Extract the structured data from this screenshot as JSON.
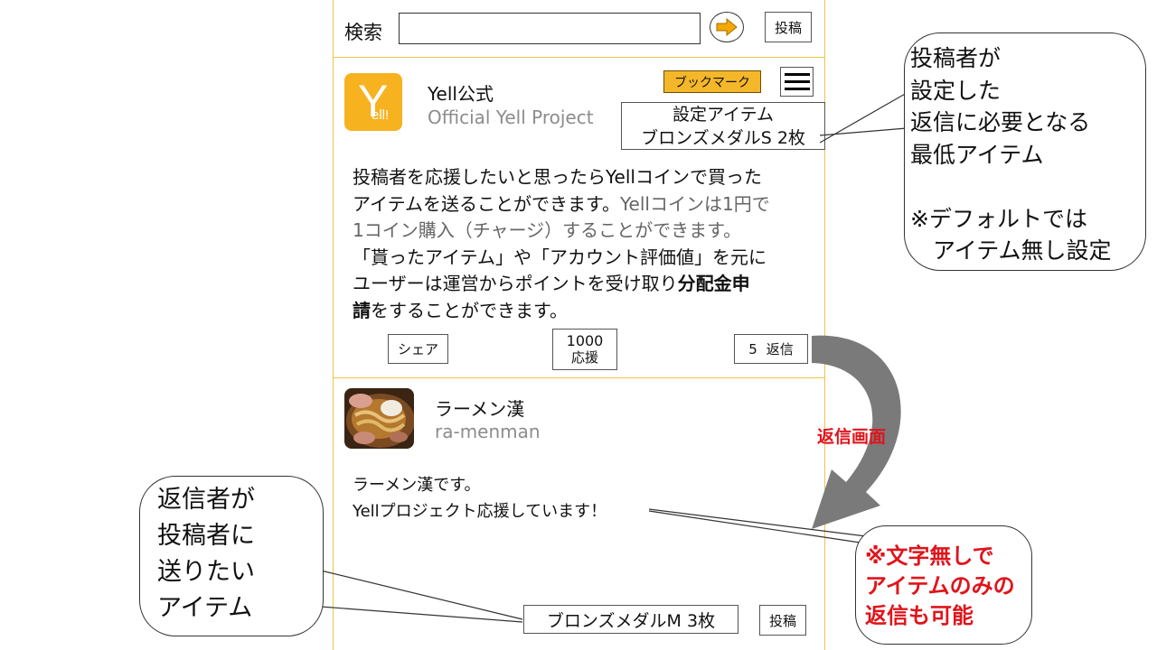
{
  "search": {
    "label": "検索",
    "value": "",
    "post_label": "投稿"
  },
  "post": {
    "name": "Yell公式",
    "handle": "Official Yell Project",
    "avatar_letter": "Y",
    "avatar_text": "ell!",
    "bookmark_label": "ブックマーク",
    "setting_item_line1": "設定アイテム",
    "setting_item_line2": "ブロンズメダルS 2枚",
    "body_1": "投稿者を応援したいと思ったらYellコインで買った",
    "body_2a": "アイテムを送ることができます。",
    "body_2b": "Yellコインは1円で",
    "body_3": "1コイン購入（チャージ）することができます。",
    "body_4": "「貰ったアイテム」や「アカウント評価値」を元に",
    "body_5a": "ユーザーは運営からポイントを受け取り",
    "body_5b": "分配金申",
    "body_6a": "請",
    "body_6b": "をすることができます。",
    "share_label": "シェア",
    "support_count": "1000",
    "support_label": "応援",
    "reply_count": "5",
    "reply_label": "返信"
  },
  "reply": {
    "name": "ラーメン漢",
    "handle": "ra-menman",
    "text_1": "ラーメン漢です。",
    "text_2": "Yellプロジェクト応援しています！",
    "item_value": "ブロンズメダルM 3枚",
    "post_label": "投稿"
  },
  "annotations": {
    "top_right": [
      "投稿者が",
      "設定した",
      "返信に必要となる",
      "最低アイテム",
      "",
      "※デフォルトでは",
      "　アイテム無し設定"
    ],
    "left": [
      "返信者が",
      "投稿者に",
      "送りたい",
      "アイテム"
    ],
    "arrow_label": "返信画面",
    "bottom_right": [
      "※文字無しで",
      "アイテムのみの",
      "返信も可能"
    ]
  },
  "colors": {
    "accent": "#f2c24a",
    "avatar": "#f7b21f",
    "alert_red": "#e0141b"
  }
}
